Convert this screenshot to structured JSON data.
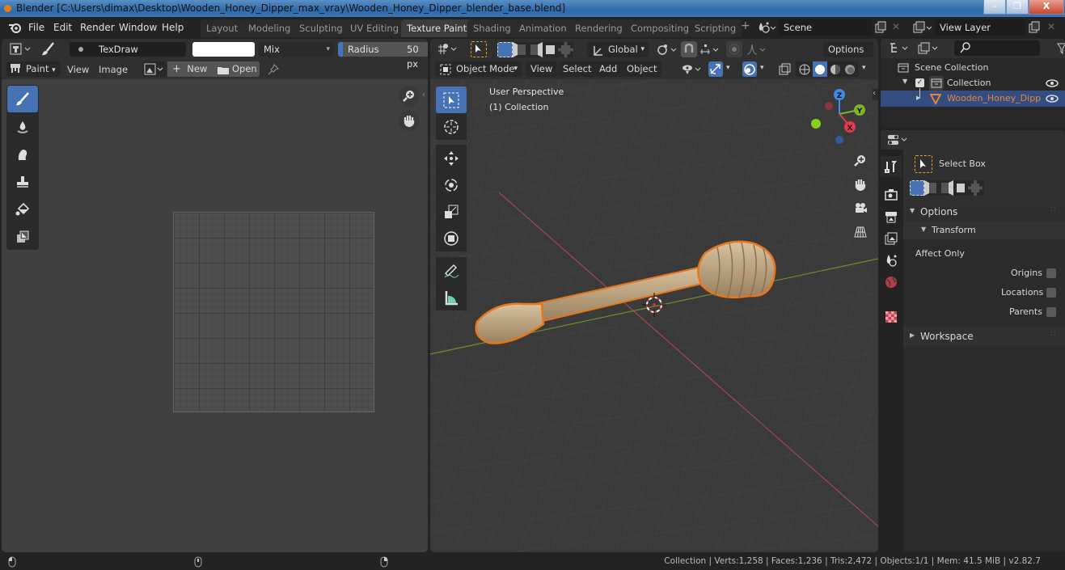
{
  "window": {
    "title": "Blender [C:\\Users\\dimax\\Desktop\\Wooden_Honey_Dipper_max_vray\\Wooden_Honey_Dipper_blender_base.blend]",
    "controls": {
      "minimize": "–",
      "maximize": "❐",
      "close": "X"
    }
  },
  "menu": [
    "File",
    "Edit",
    "Render",
    "Window",
    "Help"
  ],
  "workspace_tabs": [
    {
      "label": "Layout",
      "active": false
    },
    {
      "label": "Modeling",
      "active": false
    },
    {
      "label": "Sculpting",
      "active": false
    },
    {
      "label": "UV Editing",
      "active": false
    },
    {
      "label": "Texture Paint",
      "active": true
    },
    {
      "label": "Shading",
      "active": false
    },
    {
      "label": "Animation",
      "active": false
    },
    {
      "label": "Rendering",
      "active": false
    },
    {
      "label": "Compositing",
      "active": false
    },
    {
      "label": "Scripting",
      "active": false
    }
  ],
  "add_workspace": "+",
  "scene": {
    "value": "Scene"
  },
  "view_layer": {
    "value": "View Layer"
  },
  "image_editor": {
    "brush_name": "TexDraw",
    "color": "#ffffff",
    "blend_mode": "Mix",
    "radius_label": "Radius",
    "radius_value": "50 px",
    "mode": "Paint",
    "menus": [
      "View",
      "Image"
    ],
    "new_label": "New",
    "open_label": "Open",
    "tools": [
      "draw",
      "soften",
      "smear",
      "clone",
      "fill",
      "mask"
    ]
  },
  "viewport": {
    "transform_orientation": "Global",
    "options_label": "Options",
    "mode": "Object Mode",
    "menus": [
      "View",
      "Select",
      "Add",
      "Object"
    ],
    "overlay_text": [
      "User Perspective",
      "(1) Collection"
    ],
    "gizmo_axes": {
      "x": "X",
      "y": "Y",
      "z": "Z"
    },
    "axis_colors": {
      "x": "#e8384f",
      "y": "#7fb32a",
      "z": "#3b8ee8"
    },
    "selection_outline": "#e8761a"
  },
  "outliner": {
    "search_placeholder": "",
    "items": [
      {
        "label": "Scene Collection",
        "level": 0
      },
      {
        "label": "Collection",
        "level": 1,
        "checked": true,
        "visible": true
      },
      {
        "label": "Wooden_Honey_Dipper_max_vray",
        "level": 2,
        "visible": true,
        "selected": true
      }
    ]
  },
  "properties": {
    "tool_name": "Select Box",
    "panels": {
      "options": "Options",
      "transform": "Transform",
      "affect_only": "Affect Only",
      "workspace": "Workspace"
    },
    "checkboxes": [
      {
        "label": "Origins",
        "checked": false
      },
      {
        "label": "Locations",
        "checked": false
      },
      {
        "label": "Parents",
        "checked": false
      }
    ]
  },
  "status": {
    "text": "Collection | Verts:1,258 | Faces:1,236 | Tris:2,472 | Objects:1/1 | Mem: 41.5 MiB | v2.82.7"
  }
}
